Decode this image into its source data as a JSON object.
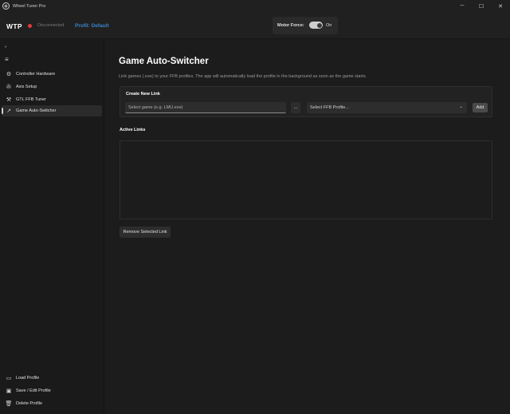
{
  "window": {
    "title": "Wheel Tuner Pro",
    "minimize": "─",
    "maximize": "☐",
    "close": "✕"
  },
  "header": {
    "logo": "WTP",
    "connection_status": "Disconnected",
    "profile_label": "Profil: Default",
    "motor_force_label": "Motor Force:",
    "motor_force_state": "On",
    "motor_force_on": true
  },
  "sidebar": {
    "items": [
      {
        "label": "Controller Hardware",
        "icon": "gear-icon"
      },
      {
        "label": "Axis Setup",
        "icon": "steering-icon"
      },
      {
        "label": "GTL FFB Tuner",
        "icon": "wrench-icon"
      },
      {
        "label": "Game Auto-Switcher",
        "icon": "arrow-icon",
        "active": true
      }
    ],
    "bottom_items": [
      {
        "label": "Load Profile",
        "icon": "load-icon"
      },
      {
        "label": "Save / Edit Profile",
        "icon": "save-icon"
      },
      {
        "label": "Delete Profile",
        "icon": "trash-icon"
      }
    ]
  },
  "main": {
    "title": "Game Auto-Switcher",
    "description": "Link games (.exe) to your FFB profiles. The app will automatically load the profile in the background as soon as the game starts.",
    "create_card": {
      "title": "Create New Link",
      "game_placeholder": "Select game (e.g. LMU.exe)",
      "browse_label": "...",
      "profile_select": "Select FFB Profile...",
      "add_label": "Add"
    },
    "active_links_title": "Active Links",
    "active_links": [],
    "remove_label": "Remove Selected Link"
  },
  "colors": {
    "accent": "#3c82c8",
    "status_disconnected": "#e03a3a"
  }
}
